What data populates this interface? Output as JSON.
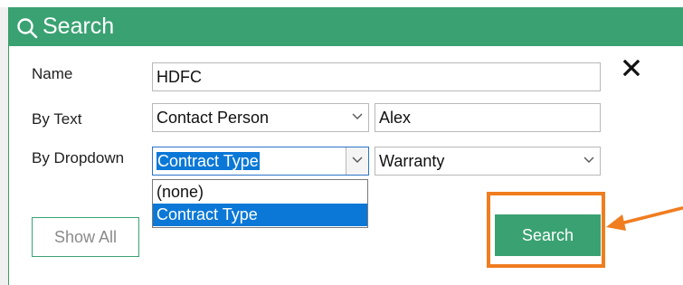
{
  "window": {
    "title": "Search"
  },
  "form": {
    "name_label": "Name",
    "name_value": "HDFC",
    "by_text_label": "By Text",
    "by_text_field": "Contact Person",
    "by_text_value": "Alex",
    "by_dropdown_label": "By Dropdown",
    "by_dropdown_field": "Contract Type",
    "by_dropdown_value": "Warranty"
  },
  "dropdown_list": {
    "options": [
      "(none)",
      "Contract Type"
    ],
    "highlighted": "Contract Type"
  },
  "buttons": {
    "show_all": "Show All",
    "search": "Search"
  },
  "icons": {
    "title": "search-icon",
    "close": "close-icon",
    "chevron": "chevron-down-icon",
    "annotation": "arrow-left-icon"
  },
  "colors": {
    "titlebar": "#3aa272",
    "accent": "#3aa272",
    "highlight": "#f07d1f",
    "selection": "#0b78d7"
  }
}
